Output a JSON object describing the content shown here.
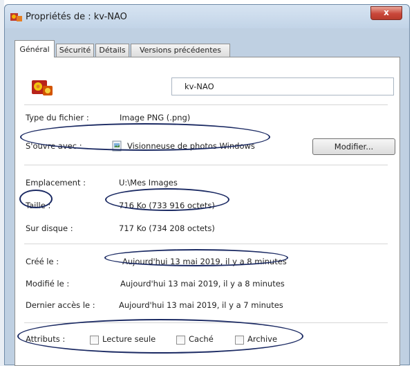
{
  "window": {
    "title": "Propriétés de : kv-NAO",
    "close_label": "x"
  },
  "tabs": [
    {
      "label": "Général",
      "active": true
    },
    {
      "label": "Sécurité",
      "active": false
    },
    {
      "label": "Détails",
      "active": false
    },
    {
      "label": "Versions précédentes",
      "active": false
    }
  ],
  "general": {
    "file_name": "kv-NAO",
    "file_type_label": "Type du fichier :",
    "file_type_value": "Image PNG (.png)",
    "opens_with_label": "S'ouvre avec :",
    "opens_with_value": "Visionneuse de photos Windows",
    "modify_button": "Modifier...",
    "location_label": "Emplacement :",
    "location_value": "U:\\Mes Images",
    "size_label": "Taille :",
    "size_value": "716 Ko (733 916 octets)",
    "size_on_disk_label": "Sur disque :",
    "size_on_disk_value": "717 Ko (734 208 octets)",
    "created_label": "Créé le :",
    "created_value": "Aujourd'hui 13 mai 2019, il y a 8 minutes",
    "modified_label": "Modifié le :",
    "modified_value": "Aujourd'hui 13 mai 2019, il y a 8 minutes",
    "accessed_label": "Dernier accès le :",
    "accessed_value": "Aujourd'hui 13 mai 2019, il y a 7 minutes",
    "attributes_label": "Attributs :",
    "attributes": [
      {
        "label": "Lecture seule",
        "checked": false
      },
      {
        "label": "Caché",
        "checked": false
      },
      {
        "label": "Archive",
        "checked": false
      }
    ]
  },
  "colors": {
    "annotation_ellipse": "#1b2a63",
    "titlebar": "#c2d4e7",
    "close_button": "#c9473a"
  },
  "icons": {
    "file_icon": "png-image-file-icon",
    "program_icon": "photo-viewer-icon"
  }
}
